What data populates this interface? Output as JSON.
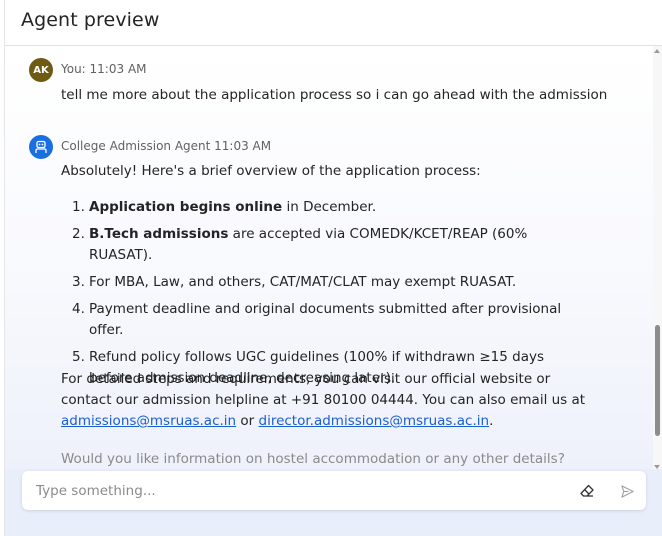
{
  "header": {
    "title": "Agent preview"
  },
  "messages": {
    "user": {
      "avatar_initials": "AK",
      "meta": "You: 11:03 AM",
      "text": "tell me more about the application process so i can go ahead with the admission"
    },
    "agent": {
      "meta": "College Admission Agent 11:03 AM",
      "intro": "Absolutely! Here's a brief overview of the application process:",
      "steps": [
        {
          "num": "1.",
          "bold": "Application begins online",
          "rest": " in December."
        },
        {
          "num": "2.",
          "bold": "B.Tech admissions",
          "rest": " are accepted via COMEDK/KCET/REAP (60% RUASAT)."
        },
        {
          "num": "3.",
          "bold": "",
          "rest": "For MBA, Law, and others, CAT/MAT/CLAT may exempt RUASAT."
        },
        {
          "num": "4.",
          "bold": "",
          "rest": "Payment deadline and original documents submitted after provisional offer."
        },
        {
          "num": "5.",
          "bold": "",
          "rest": "Refund policy follows UGC guidelines (100% if withdrawn ≥15 days before admission deadline, decreasing later)."
        }
      ],
      "contact_text_1": "For detailed steps and requirements, you can visit our official website or contact our admission helpline at +91 80100 04444. You can also email us at ",
      "email_1": "admissions@msruas.ac.in",
      "contact_or": " or ",
      "email_2": "director.admissions@msruas.ac.in",
      "contact_end": ".",
      "followup": "Would you like information on hostel accommodation or any other details?"
    }
  },
  "composer": {
    "placeholder": "Type something...",
    "value": ""
  },
  "icons": {
    "clear": "eraser-icon",
    "send": "send-icon",
    "agent_avatar": "bot-icon"
  },
  "colors": {
    "user_avatar": "#6d5a13",
    "agent_avatar": "#1a6fe0",
    "link": "#1a5fd0"
  }
}
